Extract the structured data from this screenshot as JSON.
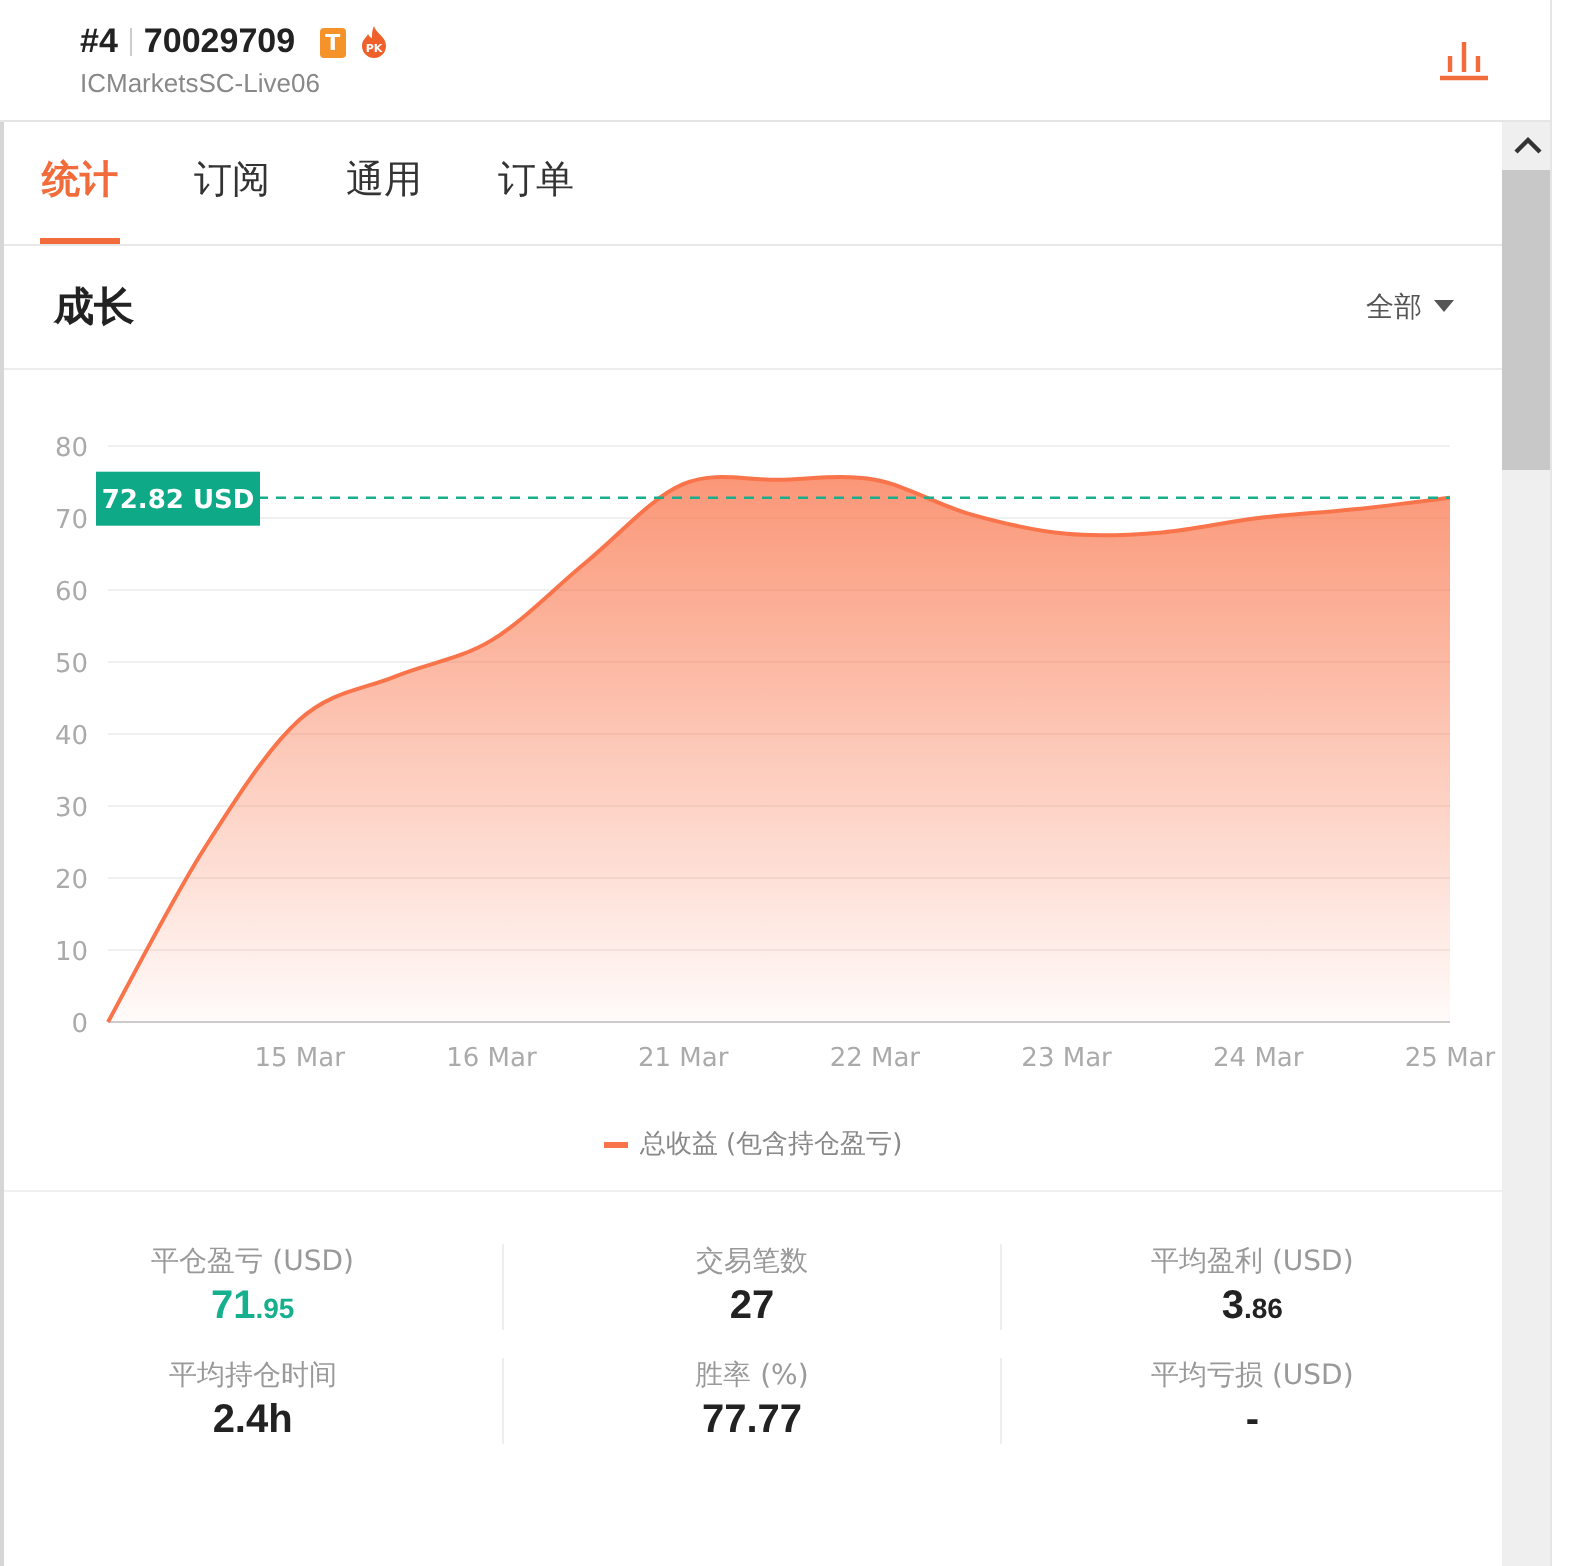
{
  "account": {
    "rank": "#4",
    "number": "70029709",
    "badge": "T",
    "pk": "PK",
    "server": "ICMarketsSC-Live06"
  },
  "tabs": [
    {
      "label": "统计",
      "selected": true
    },
    {
      "label": "订阅",
      "selected": false
    },
    {
      "label": "通用",
      "selected": false
    },
    {
      "label": "订单",
      "selected": false
    }
  ],
  "section": {
    "title": "成长",
    "filter": "全部"
  },
  "chart_data": {
    "type": "area",
    "categories": [
      null,
      null,
      "15 Mar",
      null,
      "16 Mar",
      null,
      "21 Mar",
      null,
      "22 Mar",
      null,
      "23 Mar",
      null,
      "24 Mar",
      null,
      "25 Mar"
    ],
    "ylim": [
      0,
      80
    ],
    "yticks": [
      0,
      10,
      20,
      30,
      40,
      50,
      60,
      70,
      80
    ],
    "series": [
      {
        "name": "总收益 (包含持仓盈亏)",
        "color": "#f9744a",
        "values": [
          0,
          24,
          42,
          48,
          53,
          64,
          74.7,
          75.3,
          75.3,
          70.5,
          67.8,
          68,
          70,
          71.2,
          72.8
        ]
      }
    ],
    "grid": true,
    "ref_lines": [
      {
        "axis": "y",
        "value": 72.82,
        "color": "#1aae8c"
      }
    ],
    "annotations": [
      "72.82 USD"
    ]
  },
  "stats": [
    {
      "label": "平仓盈亏 (USD)",
      "value": "71",
      "fraction": ".95",
      "color": "#16b08f"
    },
    {
      "label": "交易笔数",
      "value": "27",
      "color": "#222222"
    },
    {
      "label": "平均盈利 (USD)",
      "value": "3",
      "fraction": ".86",
      "color": "#222222"
    },
    {
      "label": "平均持仓时间",
      "value": "2.4h",
      "color": "#222222"
    },
    {
      "label": "胜率 (%)",
      "value": "77.77",
      "color": "#222222"
    },
    {
      "label": "平均亏损 (USD)",
      "value": "-",
      "color": "#222222"
    }
  ]
}
